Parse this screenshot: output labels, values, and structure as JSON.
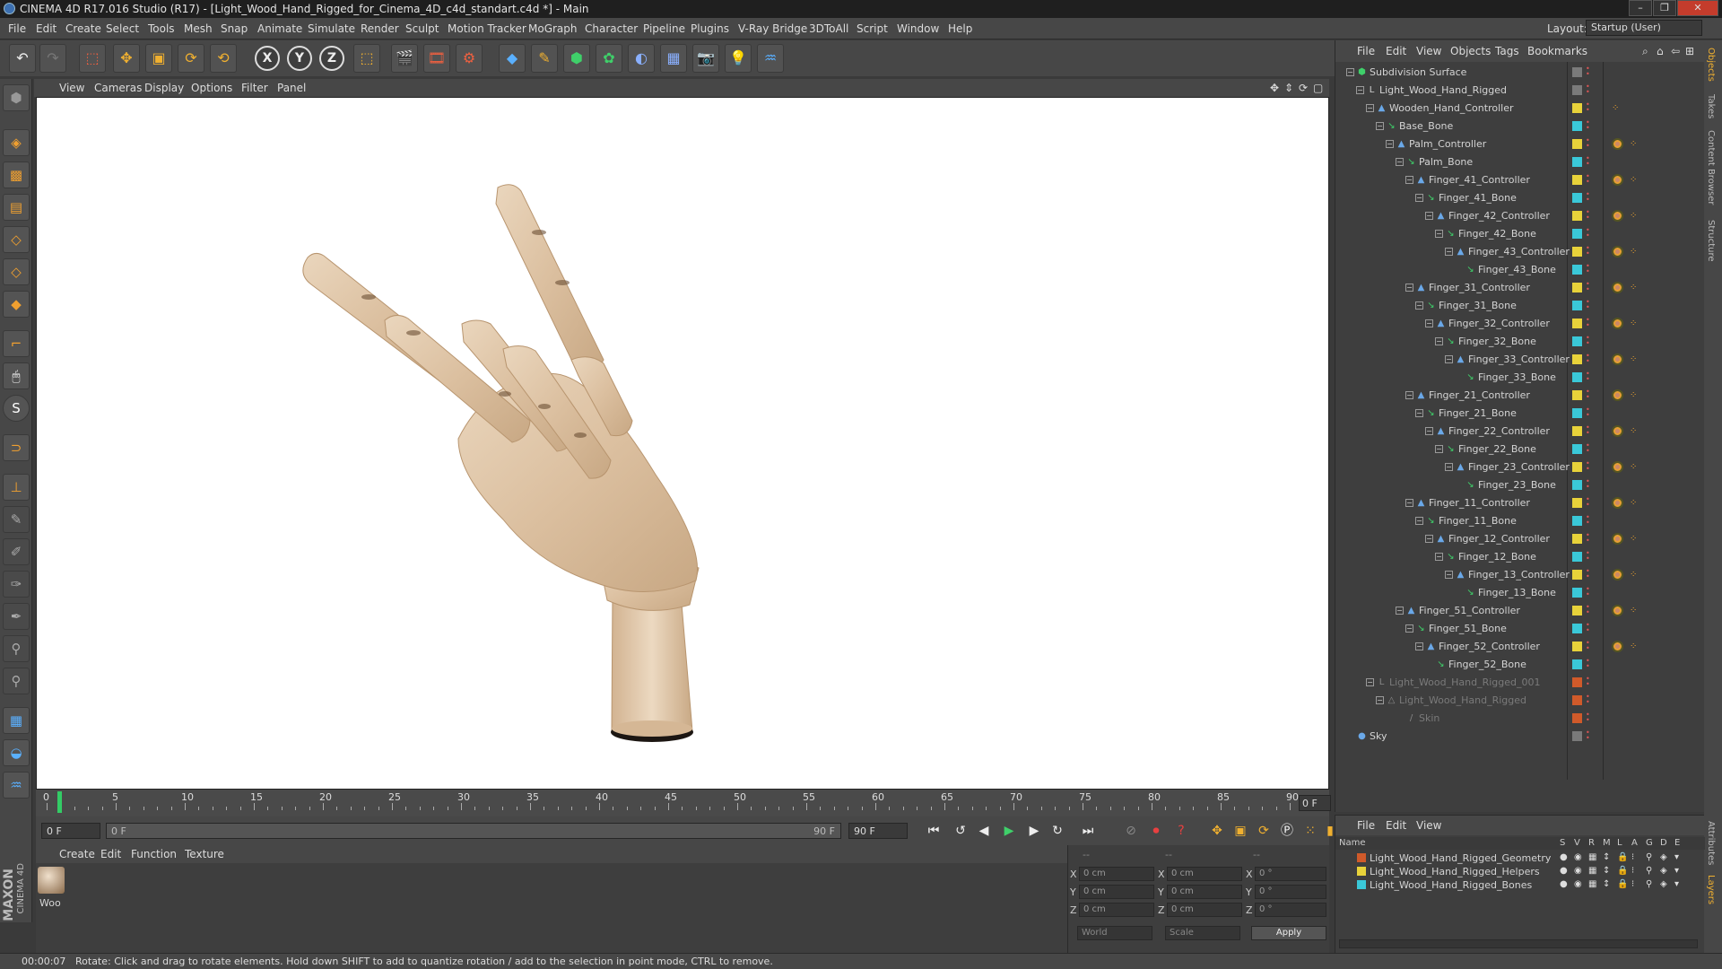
{
  "window": {
    "title": "CINEMA 4D R17.016 Studio (R17) - [Light_Wood_Hand_Rigged_for_Cinema_4D_c4d_standart.c4d *] - Main",
    "controls": [
      "–",
      "❐",
      "✕"
    ]
  },
  "menubar": {
    "items": [
      "File",
      "Edit",
      "Create",
      "Select",
      "Tools",
      "Mesh",
      "Snap",
      "Animate",
      "Simulate",
      "Render",
      "Sculpt",
      "Motion Tracker",
      "MoGraph",
      "Character",
      "Pipeline",
      "Plugins",
      "V-Ray Bridge",
      "3DToAll",
      "Script",
      "Window",
      "Help"
    ],
    "layout_label": "Layout:",
    "layout_value": "Startup (User)"
  },
  "toolbar": {
    "axis_x": "X",
    "axis_y": "Y",
    "axis_z": "Z"
  },
  "viewport": {
    "menu": [
      "View",
      "Cameras",
      "Display",
      "Options",
      "Filter",
      "Panel"
    ],
    "nav_icons": [
      "move-view-icon",
      "zoom-view-icon",
      "rotate-view-icon",
      "maximize-view-icon"
    ]
  },
  "timeline": {
    "ticks": [
      "0",
      "5",
      "10",
      "15",
      "20",
      "25",
      "30",
      "35",
      "40",
      "45",
      "50",
      "55",
      "60",
      "65",
      "70",
      "75",
      "80",
      "85",
      "90"
    ],
    "current_frame": "0 F"
  },
  "transport": {
    "start_field": "0 F",
    "range_start": "0 F",
    "range_end": "90 F",
    "end_field": "90 F"
  },
  "materials": {
    "menu": [
      "Create",
      "Edit",
      "Function",
      "Texture"
    ],
    "items": [
      {
        "label": "Woo"
      }
    ]
  },
  "coordinates": {
    "header": [
      "--",
      "--",
      "--"
    ],
    "rows": [
      {
        "axis": "X",
        "pos": "0 cm",
        "size_axis": "X",
        "size": "0 cm",
        "rot_axis": "X",
        "rot": "0 °"
      },
      {
        "axis": "Y",
        "pos": "0 cm",
        "size_axis": "Y",
        "size": "0 cm",
        "rot_axis": "Y",
        "rot": "0 °"
      },
      {
        "axis": "Z",
        "pos": "0 cm",
        "size_axis": "Z",
        "size": "0 cm",
        "rot_axis": "Z",
        "rot": "0 °"
      }
    ],
    "mode": "World",
    "size_mode": "Scale",
    "apply": "Apply"
  },
  "status": {
    "time": "00:00:07",
    "message": "Rotate: Click and drag to rotate elements. Hold down SHIFT to add to quantize rotation / add to the selection in point mode, CTRL to remove."
  },
  "object_manager": {
    "menu": [
      "File",
      "Edit",
      "View",
      "Objects",
      "Tags",
      "Bookmarks"
    ],
    "objects": [
      {
        "name": "Subdivision Surface",
        "indent": 0,
        "icon": "subdivision-icon",
        "icon_color": "#3fd06a",
        "layer": "#7a7a7a",
        "tag": false,
        "exp": "−"
      },
      {
        "name": "Light_Wood_Hand_Rigged",
        "indent": 1,
        "icon": "null-icon",
        "icon_color": "#cfcfcf",
        "layer": "#7a7a7a",
        "tag": false,
        "exp": "−"
      },
      {
        "name": "Wooden_Hand_Controller",
        "indent": 2,
        "icon": "controller-icon",
        "icon_color": "#6aa8e8",
        "layer": "#e8d23a",
        "tag": false,
        "exp": "−",
        "dots_only": true
      },
      {
        "name": "Base_Bone",
        "indent": 3,
        "icon": "bone-icon",
        "icon_color": "#3fd06a",
        "layer": "#3ac8d8",
        "tag": false,
        "exp": "−"
      },
      {
        "name": "Palm_Controller",
        "indent": 4,
        "icon": "controller-icon",
        "icon_color": "#6aa8e8",
        "layer": "#e8d23a",
        "tag": true,
        "exp": "−"
      },
      {
        "name": "Palm_Bone",
        "indent": 5,
        "icon": "bone-icon",
        "icon_color": "#3fd06a",
        "layer": "#3ac8d8",
        "tag": false,
        "exp": "−"
      },
      {
        "name": "Finger_41_Controller",
        "indent": 6,
        "icon": "controller-icon",
        "icon_color": "#6aa8e8",
        "layer": "#e8d23a",
        "tag": true,
        "exp": "−"
      },
      {
        "name": "Finger_41_Bone",
        "indent": 7,
        "icon": "bone-icon",
        "icon_color": "#3fd06a",
        "layer": "#3ac8d8",
        "tag": false,
        "exp": "−"
      },
      {
        "name": "Finger_42_Controller",
        "indent": 8,
        "icon": "controller-icon",
        "icon_color": "#6aa8e8",
        "layer": "#e8d23a",
        "tag": true,
        "exp": "−"
      },
      {
        "name": "Finger_42_Bone",
        "indent": 9,
        "icon": "bone-icon",
        "icon_color": "#3fd06a",
        "layer": "#3ac8d8",
        "tag": false,
        "exp": "−"
      },
      {
        "name": "Finger_43_Controller",
        "indent": 10,
        "icon": "controller-icon",
        "icon_color": "#6aa8e8",
        "layer": "#e8d23a",
        "tag": true,
        "exp": "−"
      },
      {
        "name": "Finger_43_Bone",
        "indent": 11,
        "icon": "bone-icon",
        "icon_color": "#3fd06a",
        "layer": "#3ac8d8",
        "tag": false,
        "exp": ""
      },
      {
        "name": "Finger_31_Controller",
        "indent": 6,
        "icon": "controller-icon",
        "icon_color": "#6aa8e8",
        "layer": "#e8d23a",
        "tag": true,
        "exp": "−"
      },
      {
        "name": "Finger_31_Bone",
        "indent": 7,
        "icon": "bone-icon",
        "icon_color": "#3fd06a",
        "layer": "#3ac8d8",
        "tag": false,
        "exp": "−"
      },
      {
        "name": "Finger_32_Controller",
        "indent": 8,
        "icon": "controller-icon",
        "icon_color": "#6aa8e8",
        "layer": "#e8d23a",
        "tag": true,
        "exp": "−"
      },
      {
        "name": "Finger_32_Bone",
        "indent": 9,
        "icon": "bone-icon",
        "icon_color": "#3fd06a",
        "layer": "#3ac8d8",
        "tag": false,
        "exp": "−"
      },
      {
        "name": "Finger_33_Controller",
        "indent": 10,
        "icon": "controller-icon",
        "icon_color": "#6aa8e8",
        "layer": "#e8d23a",
        "tag": true,
        "exp": "−"
      },
      {
        "name": "Finger_33_Bone",
        "indent": 11,
        "icon": "bone-icon",
        "icon_color": "#3fd06a",
        "layer": "#3ac8d8",
        "tag": false,
        "exp": ""
      },
      {
        "name": "Finger_21_Controller",
        "indent": 6,
        "icon": "controller-icon",
        "icon_color": "#6aa8e8",
        "layer": "#e8d23a",
        "tag": true,
        "exp": "−"
      },
      {
        "name": "Finger_21_Bone",
        "indent": 7,
        "icon": "bone-icon",
        "icon_color": "#3fd06a",
        "layer": "#3ac8d8",
        "tag": false,
        "exp": "−"
      },
      {
        "name": "Finger_22_Controller",
        "indent": 8,
        "icon": "controller-icon",
        "icon_color": "#6aa8e8",
        "layer": "#e8d23a",
        "tag": true,
        "exp": "−"
      },
      {
        "name": "Finger_22_Bone",
        "indent": 9,
        "icon": "bone-icon",
        "icon_color": "#3fd06a",
        "layer": "#3ac8d8",
        "tag": false,
        "exp": "−"
      },
      {
        "name": "Finger_23_Controller",
        "indent": 10,
        "icon": "controller-icon",
        "icon_color": "#6aa8e8",
        "layer": "#e8d23a",
        "tag": true,
        "exp": "−"
      },
      {
        "name": "Finger_23_Bone",
        "indent": 11,
        "icon": "bone-icon",
        "icon_color": "#3fd06a",
        "layer": "#3ac8d8",
        "tag": false,
        "exp": ""
      },
      {
        "name": "Finger_11_Controller",
        "indent": 6,
        "icon": "controller-icon",
        "icon_color": "#6aa8e8",
        "layer": "#e8d23a",
        "tag": true,
        "exp": "−"
      },
      {
        "name": "Finger_11_Bone",
        "indent": 7,
        "icon": "bone-icon",
        "icon_color": "#3fd06a",
        "layer": "#3ac8d8",
        "tag": false,
        "exp": "−"
      },
      {
        "name": "Finger_12_Controller",
        "indent": 8,
        "icon": "controller-icon",
        "icon_color": "#6aa8e8",
        "layer": "#e8d23a",
        "tag": true,
        "exp": "−"
      },
      {
        "name": "Finger_12_Bone",
        "indent": 9,
        "icon": "bone-icon",
        "icon_color": "#3fd06a",
        "layer": "#3ac8d8",
        "tag": false,
        "exp": "−"
      },
      {
        "name": "Finger_13_Controller",
        "indent": 10,
        "icon": "controller-icon",
        "icon_color": "#6aa8e8",
        "layer": "#e8d23a",
        "tag": true,
        "exp": "−"
      },
      {
        "name": "Finger_13_Bone",
        "indent": 11,
        "icon": "bone-icon",
        "icon_color": "#3fd06a",
        "layer": "#3ac8d8",
        "tag": false,
        "exp": ""
      },
      {
        "name": "Finger_51_Controller",
        "indent": 5,
        "icon": "controller-icon",
        "icon_color": "#6aa8e8",
        "layer": "#e8d23a",
        "tag": true,
        "exp": "−"
      },
      {
        "name": "Finger_51_Bone",
        "indent": 6,
        "icon": "bone-icon",
        "icon_color": "#3fd06a",
        "layer": "#3ac8d8",
        "tag": false,
        "exp": "−"
      },
      {
        "name": "Finger_52_Controller",
        "indent": 7,
        "icon": "controller-icon",
        "icon_color": "#6aa8e8",
        "layer": "#e8d23a",
        "tag": true,
        "exp": "−"
      },
      {
        "name": "Finger_52_Bone",
        "indent": 8,
        "icon": "bone-icon",
        "icon_color": "#3fd06a",
        "layer": "#3ac8d8",
        "tag": false,
        "exp": ""
      },
      {
        "name": "Light_Wood_Hand_Rigged_001",
        "indent": 2,
        "icon": "null-icon",
        "icon_color": "#888888",
        "layer": "#d05a2a",
        "tag": false,
        "exp": "−",
        "dim": true
      },
      {
        "name": "Light_Wood_Hand_Rigged",
        "indent": 3,
        "icon": "polygon-icon",
        "icon_color": "#888888",
        "layer": "#d05a2a",
        "tag": false,
        "exp": "−",
        "dim": true
      },
      {
        "name": "Skin",
        "indent": 5,
        "icon": "skin-icon",
        "icon_color": "#888888",
        "layer": "#d05a2a",
        "tag": false,
        "exp": "",
        "dim": true
      },
      {
        "name": "Sky",
        "indent": 0,
        "icon": "sky-icon",
        "icon_color": "#6aa8e8",
        "layer": "#7a7a7a",
        "tag": false,
        "exp": ""
      }
    ]
  },
  "side_tabs": [
    "Objects",
    "Takes",
    "Content Browser",
    "Structure",
    "Attributes",
    "Layers"
  ],
  "layer_manager": {
    "menu": [
      "File",
      "Edit",
      "View"
    ],
    "columns": [
      "Name",
      "S",
      "V",
      "R",
      "M",
      "L",
      "A",
      "G",
      "D",
      "E"
    ],
    "layers": [
      {
        "name": "Light_Wood_Hand_Rigged_Geometry",
        "color": "#d05a2a"
      },
      {
        "name": "Light_Wood_Hand_Rigged_Helpers",
        "color": "#e8d23a"
      },
      {
        "name": "Light_Wood_Hand_Rigged_Bones",
        "color": "#3ac8d8"
      }
    ]
  },
  "branding": {
    "maxon": "MAXON",
    "cinema": "CINEMA 4D"
  }
}
